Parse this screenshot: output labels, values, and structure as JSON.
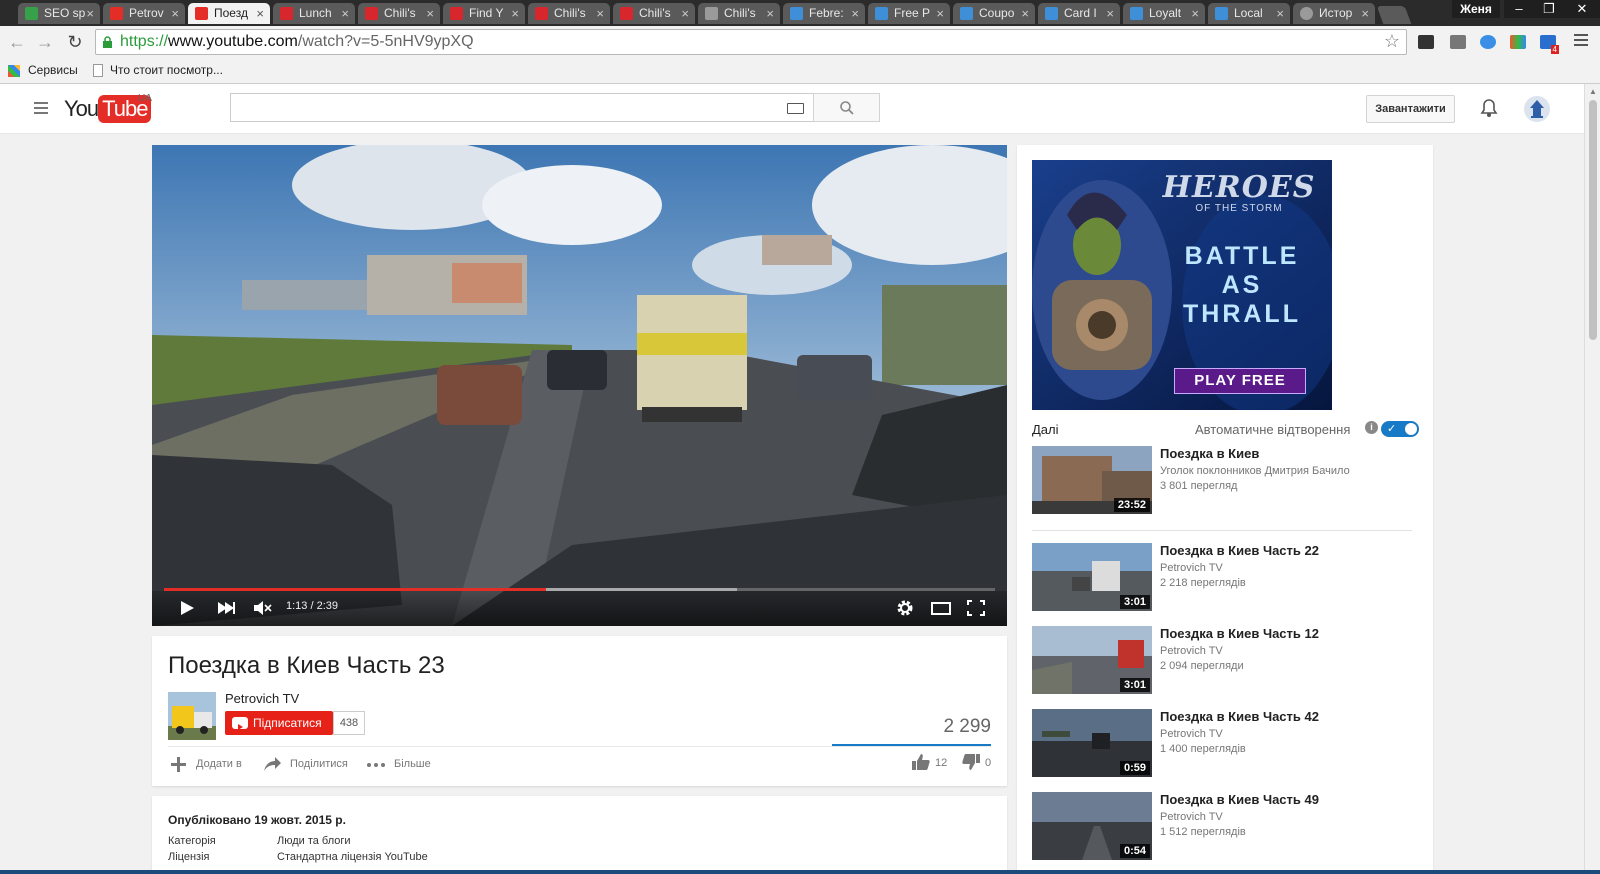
{
  "browser": {
    "tabs": [
      {
        "label": "SEO sp",
        "favicon_color": "#37a14a"
      },
      {
        "label": "Petrov",
        "favicon_color": "#e52d27"
      },
      {
        "label": "Поезд",
        "favicon_color": "#e52d27",
        "active": true
      },
      {
        "label": "Lunch",
        "favicon_color": "#d8262d"
      },
      {
        "label": "Chili's",
        "favicon_color": "#d8262d"
      },
      {
        "label": "Find Y",
        "favicon_color": "#d8262d"
      },
      {
        "label": "Chili's",
        "favicon_color": "#d8262d"
      },
      {
        "label": "Chili's",
        "favicon_color": "#d8262d"
      },
      {
        "label": "Chili's",
        "favicon_color": "#9a9a9a"
      },
      {
        "label": "Febre:",
        "favicon_color": "#3f8fd8"
      },
      {
        "label": "Free P",
        "favicon_color": "#3f8fd8"
      },
      {
        "label": "Coupo",
        "favicon_color": "#3f8fd8"
      },
      {
        "label": "Card I",
        "favicon_color": "#3f8fd8"
      },
      {
        "label": "Loyalt",
        "favicon_color": "#3f8fd8"
      },
      {
        "label": "Local",
        "favicon_color": "#3f8fd8"
      },
      {
        "label": "Истор",
        "favicon_color": "#9a9a9a"
      }
    ],
    "user": "Женя",
    "url_scheme": "https://",
    "url_host": "www.youtube.com",
    "url_path": "/watch?v=5-5nHV9ypXQ",
    "bookmarks": [
      "Сервисы",
      "Что стоит посмотр..."
    ],
    "extension_badge": "4"
  },
  "youtube": {
    "logo_you": "You",
    "logo_tube": "Tube",
    "country_code": "UA",
    "search_placeholder": "",
    "upload_label": "Завантажити"
  },
  "player": {
    "current_time": "1:13",
    "duration": "2:39",
    "time_display": "1:13 / 2:39",
    "progress_fraction": 0.46,
    "buffered_fraction": 0.69
  },
  "video": {
    "title": "Поездка в Киев Часть 23",
    "channel": "Petrovich TV",
    "subscribe_label": "Підписатися",
    "subscriber_count": "438",
    "views": "2 299",
    "actions": {
      "add": "Додати в",
      "share": "Поділитися",
      "more": "Більше"
    },
    "likes": "12",
    "dislikes": "0"
  },
  "description": {
    "published": "Опубліковано 19 жовт. 2015 р.",
    "category_label": "Категорія",
    "category_value": "Люди та блоги",
    "license_label": "Ліцензія",
    "license_value": "Стандартна ліцензія YouTube"
  },
  "ad": {
    "brand_top": "HEROES",
    "brand_sub": "OF THE STORM",
    "line1": "BATTLE",
    "line2": "AS",
    "line3": "THRALL",
    "cta": "PLAY FREE"
  },
  "sidebar": {
    "next_label": "Далі",
    "autoplay_label": "Автоматичне відтворення",
    "autoplay_on": true,
    "items": [
      {
        "title": "Поездка в Киев",
        "channel": "Уголок поклонников Дмитрия Бачило",
        "views": "3 801 перегляд",
        "duration": "23:52"
      },
      {
        "title": "Поездка в Киев Часть 22",
        "channel": "Petrovich TV",
        "views": "2 218 переглядів",
        "duration": "3:01"
      },
      {
        "title": "Поездка в Киев Часть 12",
        "channel": "Petrovich TV",
        "views": "2 094 перегляди",
        "duration": "3:01"
      },
      {
        "title": "Поездка в Киев Часть 42",
        "channel": "Petrovich TV",
        "views": "1 400 переглядів",
        "duration": "0:59"
      },
      {
        "title": "Поездка в Киев Часть 49",
        "channel": "Petrovich TV",
        "views": "1 512 переглядів",
        "duration": "0:54"
      }
    ]
  }
}
